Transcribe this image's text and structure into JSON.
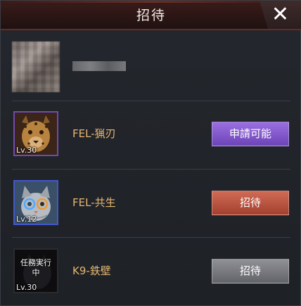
{
  "dialog": {
    "title": "招待",
    "close_glyph": "✕"
  },
  "units": [
    {
      "name": "FEL-猟刃",
      "level": "Lv.30",
      "button_label": "申請可能",
      "button_color": "#7c52c9",
      "frame_color": "#6f4bb0",
      "icon": "cheetah-icon"
    },
    {
      "name": "FEL-共生",
      "level": "Lv.12",
      "button_label": "招待",
      "button_color": "#b34e3b",
      "frame_color": "#4258c9",
      "icon": "cat-icon"
    },
    {
      "name": "K9-鉄壁",
      "level": "Lv.30",
      "status": "任務実行中",
      "button_label": "招待",
      "button_color": "#75777c",
      "frame_color": "#2b2b30",
      "icon": "dog-silhouette-icon"
    }
  ]
}
